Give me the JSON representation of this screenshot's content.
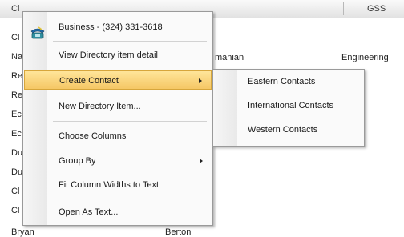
{
  "table": {
    "headers": [
      "Cl",
      "GSS"
    ],
    "row_stubs": [
      "Cl",
      "Na",
      "Re",
      "Re",
      "Ec",
      "Ec",
      "Du",
      "Du",
      "Cl",
      "Cl"
    ],
    "cells": {
      "manian": "manian",
      "engineering": "Engineering",
      "last_row_first": "Bryan",
      "last_row_last": "Berton"
    }
  },
  "context_menu": {
    "phone_item": "Business - (324) 331-3618",
    "items": [
      "View Directory item detail",
      "Create Contact",
      "New Directory Item...",
      "Choose Columns",
      "Group By",
      "Fit Column Widths to Text",
      "Open As Text..."
    ],
    "highlighted_index": 1
  },
  "create_contact_submenu": {
    "items": [
      "Eastern Contacts",
      "International Contacts",
      "Western Contacts"
    ]
  },
  "colors": {
    "highlight_top": "#ffe59a",
    "highlight_bottom": "#f5c765",
    "highlight_border": "#d7a63c",
    "menu_bg": "#fafafa"
  },
  "icons": {
    "phone_item": "phone-icon",
    "submenu_arrows": "chevron-right-icon"
  }
}
